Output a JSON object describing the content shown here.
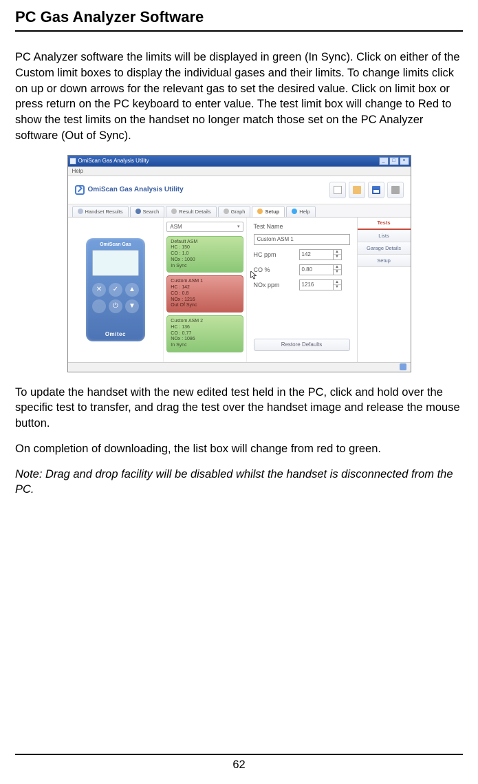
{
  "page": {
    "title": "PC Gas Analyzer Software",
    "number": "62"
  },
  "paragraphs": {
    "p1": "PC Analyzer software the limits will be displayed in green (In Sync). Click on either of the Custom limit boxes to display the individual gases and their limits. To change limits click on up or down arrows for the relevant gas to set the desired value. Click on limit box or press return on the PC keyboard to enter value. The test limit box will change to Red to show the test limits on the handset no longer match those set on the PC Analyzer software (Out of Sync).",
    "p2": "To update the handset with the new edited test held in the PC, click and hold over the specific test to transfer, and drag the test over the handset image and release the mouse button.",
    "p3": "On completion of downloading, the list box will change from red to green.",
    "p4": "Note: Drag and drop facility will be disabled whilst the handset is disconnected from the PC."
  },
  "app": {
    "window_title": "OmiScan Gas Analysis Utility",
    "menu": {
      "help": "Help"
    },
    "brand": "OmiScan Gas Analysis Utility",
    "tabs": {
      "handset": "Handset Results",
      "search": "Search",
      "result": "Result Details",
      "graph": "Graph",
      "setup": "Setup",
      "help": "Help"
    },
    "handset": {
      "brand_top": "OmiScan Gas",
      "brand_bottom": "Omitec"
    },
    "group_label": "ASM",
    "boxes": {
      "b1": {
        "title": "Default ASM",
        "hc": "HC : 150",
        "co": "CO : 1.0",
        "nox": "NOx : 1000",
        "sync": "In Sync"
      },
      "b2": {
        "title": "Custom ASM 1",
        "hc": "HC : 142",
        "co": "CO : 0.8",
        "nox": "NOx : 1216",
        "sync": "Out Of Sync"
      },
      "b3": {
        "title": "Custom ASM 2",
        "hc": "HC : 136",
        "co": "CO : 0.77",
        "nox": "NOx : 1086",
        "sync": "In Sync"
      }
    },
    "form": {
      "test_name_label": "Test Name",
      "test_name_value": "Custom ASM 1",
      "hc_label": "HC ppm",
      "hc_value": "142",
      "co_label": "CO %",
      "co_value": "0.80",
      "nox_label": "NOx ppm",
      "nox_value": "1216",
      "restore": "Restore Defaults"
    },
    "side": {
      "tests": "Tests",
      "lists": "Lists",
      "garage": "Garage Details",
      "setup": "Setup"
    },
    "winbtns": {
      "min": "_",
      "max": "□",
      "close": "×"
    }
  }
}
